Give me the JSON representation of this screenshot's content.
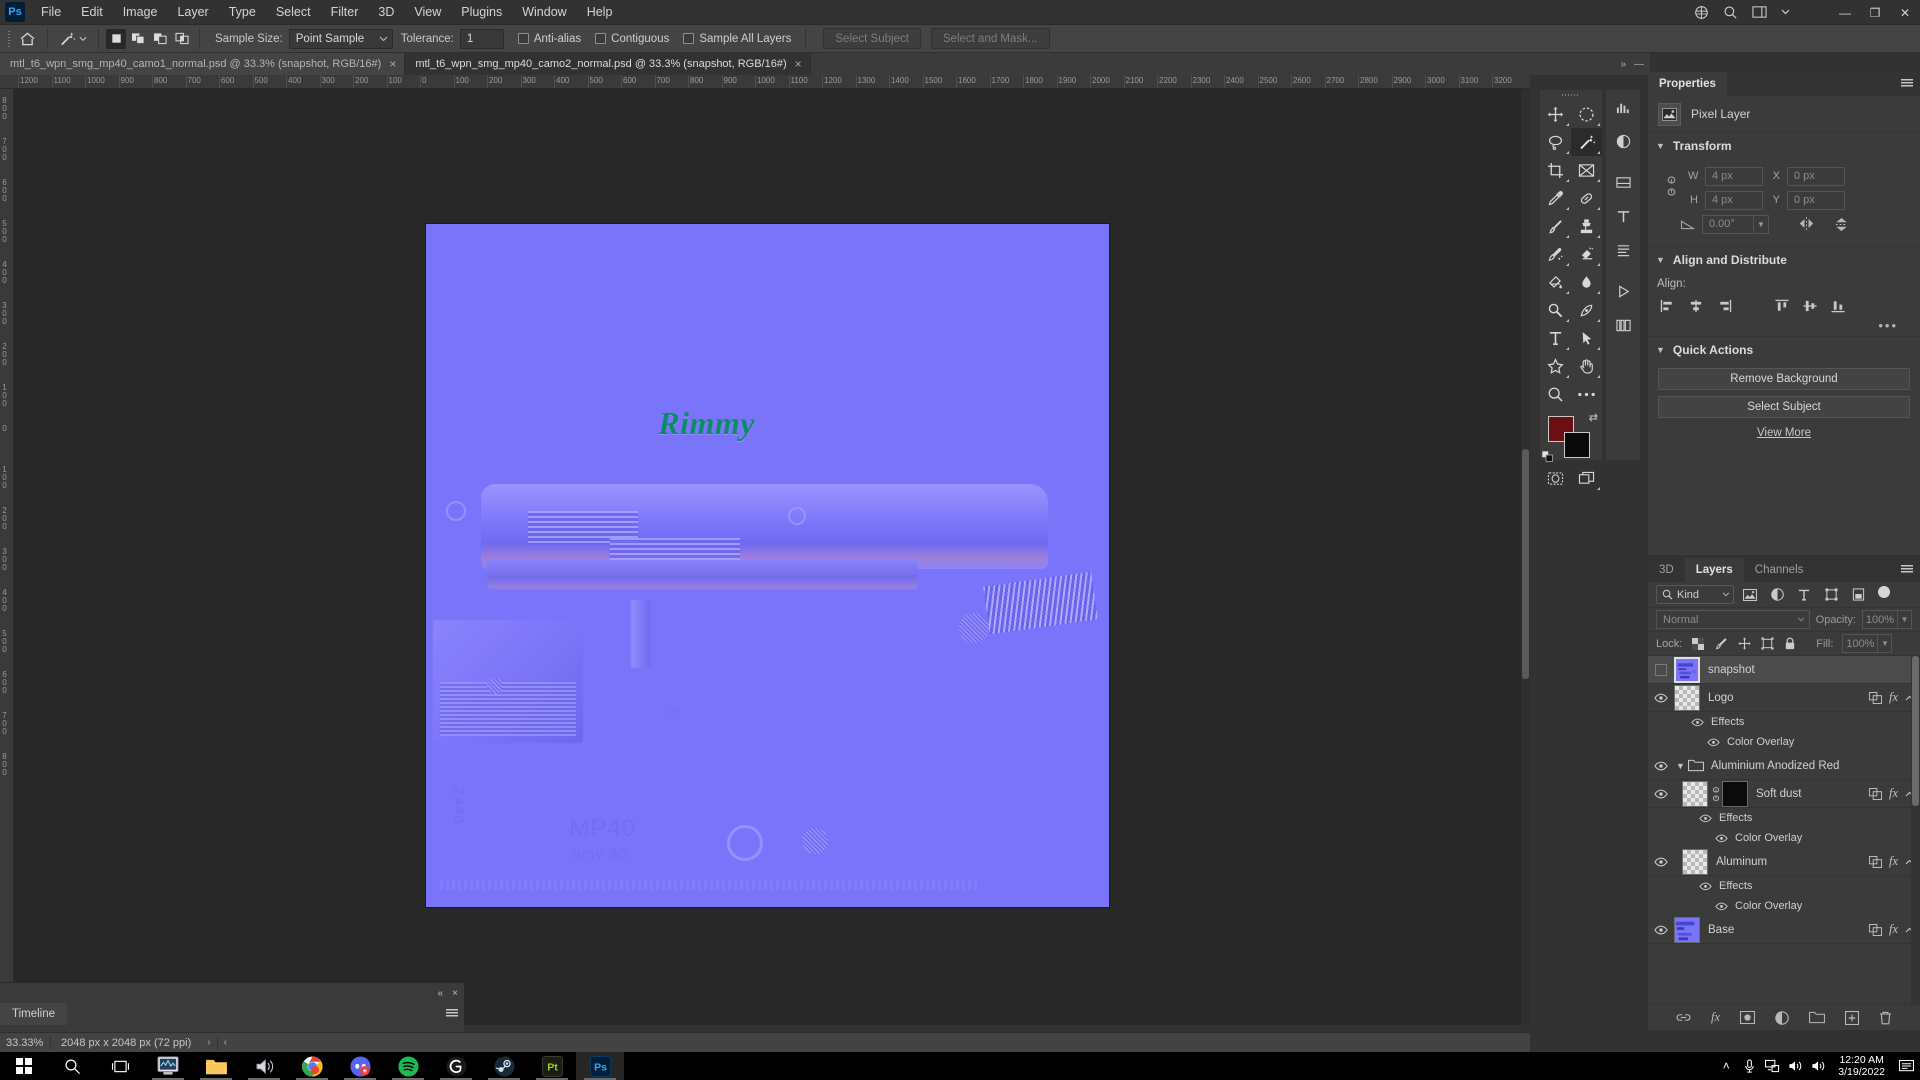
{
  "app": {
    "name": "Adobe Photoshop",
    "logo_text": "Ps"
  },
  "menubar": {
    "items": [
      "File",
      "Edit",
      "Image",
      "Layer",
      "Type",
      "Select",
      "Filter",
      "3D",
      "View",
      "Plugins",
      "Window",
      "Help"
    ],
    "window_controls": {
      "minimize": "—",
      "maximize": "❐",
      "close": "✕"
    },
    "right_icons": [
      "share-icon",
      "search-icon",
      "workspace-icon",
      "chevron-down-icon"
    ]
  },
  "options_bar": {
    "home_icon": "home-icon",
    "tool_icon": "magic-wand-icon",
    "selection_modes": [
      "new-selection",
      "add-to-selection",
      "subtract-from-selection",
      "intersect-with-selection"
    ],
    "sample_size_label": "Sample Size:",
    "sample_size_value": "Point Sample",
    "tolerance_label": "Tolerance:",
    "tolerance_value": "1",
    "anti_alias_label": "Anti-alias",
    "anti_alias_checked": false,
    "contiguous_label": "Contiguous",
    "contiguous_checked": false,
    "sample_all_layers_label": "Sample All Layers",
    "sample_all_layers_checked": false,
    "select_subject_label": "Select Subject",
    "select_and_mask_label": "Select and Mask..."
  },
  "tabs": [
    {
      "title": "mtl_t6_wpn_smg_mp40_camo1_normal.psd @ 33.3% (snapshot, RGB/16#)",
      "active": false,
      "close": "×"
    },
    {
      "title": "mtl_t6_wpn_smg_mp40_camo2_normal.psd @ 33.3% (snapshot, RGB/16#)",
      "active": true,
      "close": "×"
    }
  ],
  "rulers": {
    "horizontal": [
      "1200",
      "1100",
      "1000",
      "900",
      "800",
      "700",
      "600",
      "500",
      "400",
      "300",
      "200",
      "100",
      "0",
      "100",
      "200",
      "300",
      "400",
      "500",
      "600",
      "700",
      "800",
      "900",
      "1000",
      "1100",
      "1200",
      "1300",
      "1400",
      "1500",
      "1600",
      "1700",
      "1800",
      "1900",
      "2000",
      "2100",
      "2200",
      "2300",
      "2400",
      "2500",
      "2600",
      "2700",
      "2800",
      "2900",
      "3000",
      "3100",
      "3200"
    ],
    "vertical": [
      "800",
      "700",
      "600",
      "500",
      "400",
      "300",
      "200",
      "100",
      "0",
      "100",
      "200",
      "300",
      "400",
      "500",
      "600",
      "700",
      "800"
    ]
  },
  "canvas": {
    "document_logo_text": "Rimmy",
    "texture_labels": [
      "MP40",
      "amv 80",
      "2440",
      "286"
    ],
    "base_color": "#7b72ff",
    "logo_color": "#0d8a6a"
  },
  "properties_panel": {
    "tab_label": "Properties",
    "layer_type": "Pixel Layer",
    "layer_type_icon": "pixel-layer-icon",
    "transform": {
      "title": "Transform",
      "w_label": "W",
      "w_value": "4 px",
      "h_label": "H",
      "h_value": "4 px",
      "x_label": "X",
      "x_value": "0 px",
      "y_label": "Y",
      "y_value": "0 px",
      "angle_value": "0.00°",
      "link_icon": "link-icon",
      "flip_horizontal_icon": "flip-horizontal-icon",
      "flip_vertical_icon": "flip-vertical-icon"
    },
    "align": {
      "title": "Align and Distribute",
      "label": "Align:",
      "buttons": [
        "align-left-edges",
        "align-horizontal-centers",
        "align-right-edges",
        "align-top-edges",
        "align-vertical-centers",
        "align-bottom-edges"
      ],
      "more": "•••"
    },
    "quick_actions": {
      "title": "Quick Actions",
      "remove_background": "Remove Background",
      "select_subject": "Select Subject",
      "view_more": "View More"
    }
  },
  "layers_panel": {
    "tabs": [
      {
        "label": "3D",
        "active": false
      },
      {
        "label": "Layers",
        "active": true
      },
      {
        "label": "Channels",
        "active": false
      }
    ],
    "filter": {
      "kind_label": "Kind",
      "search_icon": "search-icon",
      "filter_icons": [
        "pixel-filter-icon",
        "adjustment-filter-icon",
        "type-filter-icon",
        "shape-filter-icon",
        "smart-object-filter-icon"
      ],
      "toggle_icon": "filter-toggle-switch"
    },
    "blend": {
      "mode": "Normal",
      "opacity_label": "Opacity:",
      "opacity_value": "100%"
    },
    "lock": {
      "label": "Lock:",
      "icons": [
        "lock-transparent-pixels-icon",
        "lock-image-pixels-icon",
        "lock-position-icon",
        "lock-artboard-nesting-icon",
        "lock-all-icon"
      ],
      "fill_label": "Fill:",
      "fill_value": "100%"
    },
    "layers": [
      {
        "name": "snapshot",
        "visible": false,
        "selected": true,
        "thumb": "snapshot",
        "has_fx": false,
        "has_link": false,
        "indent": 0,
        "type": "layer"
      },
      {
        "name": "Logo",
        "visible": true,
        "selected": false,
        "thumb": "transparent",
        "has_fx": true,
        "has_link": true,
        "indent": 0,
        "type": "layer"
      },
      {
        "name": "Effects",
        "visible": true,
        "indent": 1,
        "type": "effects"
      },
      {
        "name": "Color Overlay",
        "visible": true,
        "indent": 2,
        "type": "effect"
      },
      {
        "name": "Aluminium Anodized Red",
        "visible": true,
        "indent": 0,
        "type": "group"
      },
      {
        "name": "Soft dust",
        "visible": true,
        "thumb": "masked",
        "has_fx": true,
        "has_link": true,
        "indent": 1,
        "type": "layer"
      },
      {
        "name": "Effects",
        "visible": true,
        "indent": 2,
        "type": "effects"
      },
      {
        "name": "Color Overlay",
        "visible": true,
        "indent": 3,
        "type": "effect"
      },
      {
        "name": "Aluminum",
        "visible": true,
        "thumb": "transparent",
        "has_fx": true,
        "has_link": true,
        "indent": 1,
        "type": "layer"
      },
      {
        "name": "Effects",
        "visible": true,
        "indent": 2,
        "type": "effects"
      },
      {
        "name": "Color Overlay",
        "visible": true,
        "indent": 3,
        "type": "effect"
      },
      {
        "name": "Base",
        "visible": true,
        "thumb": "base",
        "has_fx": true,
        "has_link": true,
        "indent": 1,
        "type": "layer"
      }
    ],
    "footer_icons": [
      "link-layers-icon",
      "add-layer-style-icon",
      "add-layer-mask-icon",
      "new-fill-adjustment-icon",
      "new-group-icon",
      "new-layer-icon",
      "delete-layer-icon"
    ]
  },
  "timeline_panel": {
    "tab_label": "Timeline",
    "collapse_icon": "«",
    "close_icon": "×",
    "menu_icon": "panel-menu-icon"
  },
  "status_bar": {
    "zoom": "33.33%",
    "doc_size": "2048 px x 2048 px (72 ppi)",
    "next_arrow": "›",
    "prev_arrow": "‹"
  },
  "toolbar": {
    "tools": [
      {
        "name": "move-tool",
        "active": false
      },
      {
        "name": "rectangular-marquee-tool",
        "active": false
      },
      {
        "name": "lasso-tool",
        "active": false
      },
      {
        "name": "magic-wand-tool",
        "active": true
      },
      {
        "name": "crop-tool",
        "active": false
      },
      {
        "name": "frame-tool",
        "active": false
      },
      {
        "name": "eyedropper-tool",
        "active": false
      },
      {
        "name": "spot-healing-brush-tool",
        "active": false
      },
      {
        "name": "brush-tool",
        "active": false
      },
      {
        "name": "clone-stamp-tool",
        "active": false
      },
      {
        "name": "history-brush-tool",
        "active": false
      },
      {
        "name": "eraser-tool",
        "active": false
      },
      {
        "name": "gradient-tool",
        "active": false
      },
      {
        "name": "blur-tool",
        "active": false
      },
      {
        "name": "dodge-tool",
        "active": false
      },
      {
        "name": "pen-tool",
        "active": false
      },
      {
        "name": "type-tool",
        "active": false
      },
      {
        "name": "path-selection-tool",
        "active": false
      },
      {
        "name": "custom-shape-tool",
        "active": false
      },
      {
        "name": "hand-tool",
        "active": false
      },
      {
        "name": "zoom-tool",
        "active": false
      },
      {
        "name": "edit-toolbar-tool",
        "active": false
      }
    ],
    "foreground_color": "#6b0f12",
    "background_color": "#0a0a0a",
    "quick_mask": "quick-mask-mode-icon",
    "screen_mode": "screen-mode-icon"
  },
  "dock_strip": {
    "icons": [
      "histogram-icon",
      "adjustments-icon",
      "color-icon",
      "character-icon",
      "paragraph-icon",
      "actions-icon",
      "libraries-icon"
    ]
  },
  "taskbar": {
    "items": [
      {
        "name": "start-button",
        "label": "Windows",
        "running": false
      },
      {
        "name": "search-button",
        "label": "Search",
        "running": false
      },
      {
        "name": "task-view-button",
        "label": "Task View",
        "running": false
      },
      {
        "name": "task-manager-app",
        "label": "Task Manager",
        "running": true
      },
      {
        "name": "file-explorer-app",
        "label": "File Explorer",
        "running": true
      },
      {
        "name": "volume-mixer-app",
        "label": "Volume",
        "running": true
      },
      {
        "name": "chrome-app",
        "label": "Google Chrome",
        "running": true
      },
      {
        "name": "discord-app",
        "label": "Discord",
        "running": true
      },
      {
        "name": "spotify-app",
        "label": "Spotify",
        "running": true
      },
      {
        "name": "logitech-g-app",
        "label": "Logitech G HUB",
        "running": true
      },
      {
        "name": "steam-app",
        "label": "Steam",
        "running": true
      },
      {
        "name": "substance-painter-app",
        "label": "Pt",
        "running": true
      },
      {
        "name": "photoshop-app",
        "label": "Ps",
        "running": true,
        "active": true
      }
    ],
    "tray": {
      "expand_icon": "˄",
      "icons": [
        "microphone-icon",
        "network-icon",
        "volume-icon",
        "volume-2-icon"
      ],
      "time": "12:20 AM",
      "date": "3/19/2022",
      "notification_icon": "notification-center-icon"
    }
  }
}
